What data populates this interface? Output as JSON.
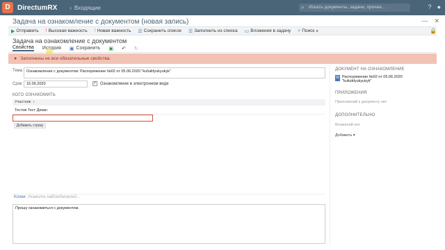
{
  "topbar": {
    "brand": "DirectumRX",
    "nav_label": "Входящие",
    "search_placeholder": "Искать документы, задачи, прочее..."
  },
  "window": {
    "title": "Задача на ознакомление с документом (новая запись)"
  },
  "toolbar": {
    "send": "Отправить",
    "high_importance": "Высокая важность",
    "new_importance": "Новая важность",
    "save_list": "Сохранить список",
    "fill_from_list": "Заполнить из списка",
    "attach_to_task": "Вложения в задачу",
    "search": "Поиск"
  },
  "form": {
    "subtitle": "Задача на ознакомление с документом",
    "tabs": {
      "properties": "Свойства",
      "history": "История",
      "save": "Сохранить"
    },
    "alert": "Заполнены не все обязательные свойства.",
    "subject_label": "Тема",
    "subject_value": "Ознакомление с документом: Распоряжение №02 от 05.06.2020 \"kufuikfyukyukyk\"",
    "deadline_label": "Срок",
    "deadline_value": "15.06.2020",
    "electronic_checkbox_label": "Ознакомление в электронном виде",
    "whom_section": "КОГО ОЗНАКОМИТЬ",
    "participants_header": "Участник",
    "participants": [
      "Тестов Тест Декан"
    ],
    "add_row": "Добавить строку",
    "copies_label": "Копии",
    "copies_placeholder": "Укажите наблюдателей...",
    "message": "Прошу ознакомиться с документом."
  },
  "sidebar": {
    "doc_section": "ДОКУМЕНТ НА ОЗНАКОМЛЕНИЕ",
    "doc_name": "Распоряжение №02 от 05.06.2020 \"kufuikfyukyukyk\"",
    "appendices_section": "ПРИЛОЖЕНИЯ",
    "appendices_placeholder": "Приложений к документу нет",
    "additional_section": "ДОПОЛНИТЕЛЬНО",
    "additional_placeholder": "Вложений нет",
    "add_label": "Добавить"
  }
}
